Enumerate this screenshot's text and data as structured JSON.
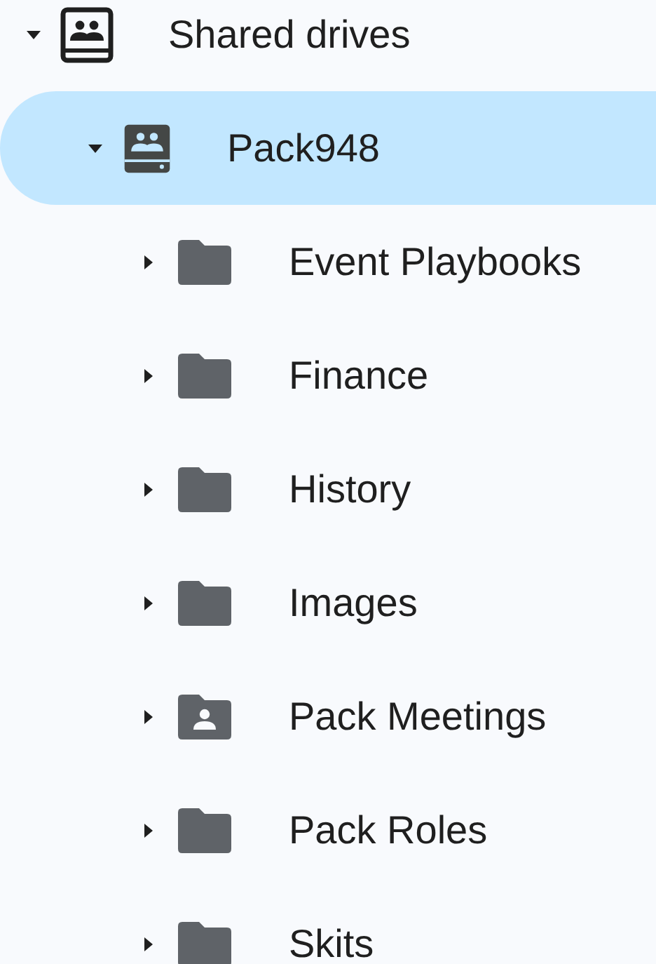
{
  "tree": [
    {
      "label": "Shared drives",
      "kind": "drives",
      "expanded": true,
      "selected": false,
      "children": [
        {
          "label": "Pack948",
          "kind": "drive",
          "expanded": true,
          "selected": true,
          "children": [
            {
              "label": "Event Playbooks",
              "kind": "folder",
              "expanded": false,
              "selected": false
            },
            {
              "label": "Finance",
              "kind": "folder",
              "expanded": false,
              "selected": false
            },
            {
              "label": "History",
              "kind": "folder",
              "expanded": false,
              "selected": false
            },
            {
              "label": "Images",
              "kind": "folder",
              "expanded": false,
              "selected": false
            },
            {
              "label": "Pack Meetings",
              "kind": "shared-folder",
              "expanded": false,
              "selected": false
            },
            {
              "label": "Pack Roles",
              "kind": "folder",
              "expanded": false,
              "selected": false
            },
            {
              "label": "Skits",
              "kind": "folder",
              "expanded": false,
              "selected": false
            }
          ]
        }
      ]
    }
  ]
}
